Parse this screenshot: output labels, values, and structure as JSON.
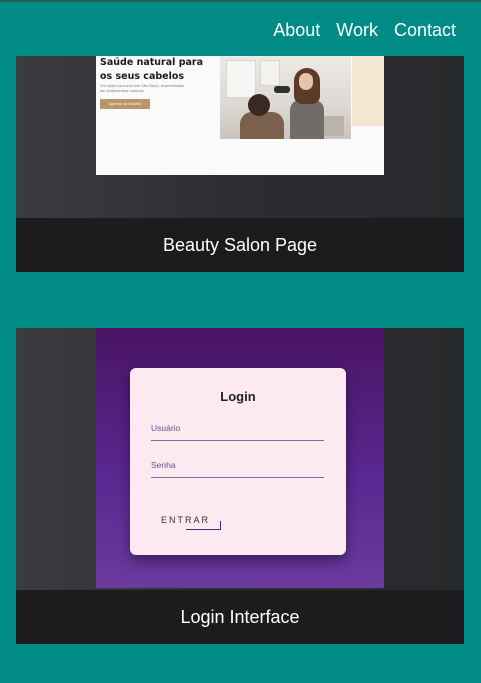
{
  "nav": {
    "links": [
      "About",
      "Work",
      "Contact"
    ]
  },
  "projects": [
    {
      "caption": "Beauty Salon Page",
      "preview": {
        "headline": "Saúde natural para os seus cabelos",
        "subtext": "Um salão exclusivo em São Paulo, especializado em tratamentos naturais.",
        "button": "Agende na Estúdio"
      }
    },
    {
      "caption": "Login Interface",
      "preview": {
        "title": "Login",
        "user_label": "Usuário",
        "password_label": "Senha",
        "button": "ENTRAR"
      }
    }
  ],
  "colors": {
    "background": "#008b87",
    "card": "#1c1c1e",
    "salon_accent": "#b8966a",
    "login_gradient_top": "#4a1463",
    "login_gradient_bottom": "#6a3b9e",
    "login_box": "#fdeaf1"
  }
}
